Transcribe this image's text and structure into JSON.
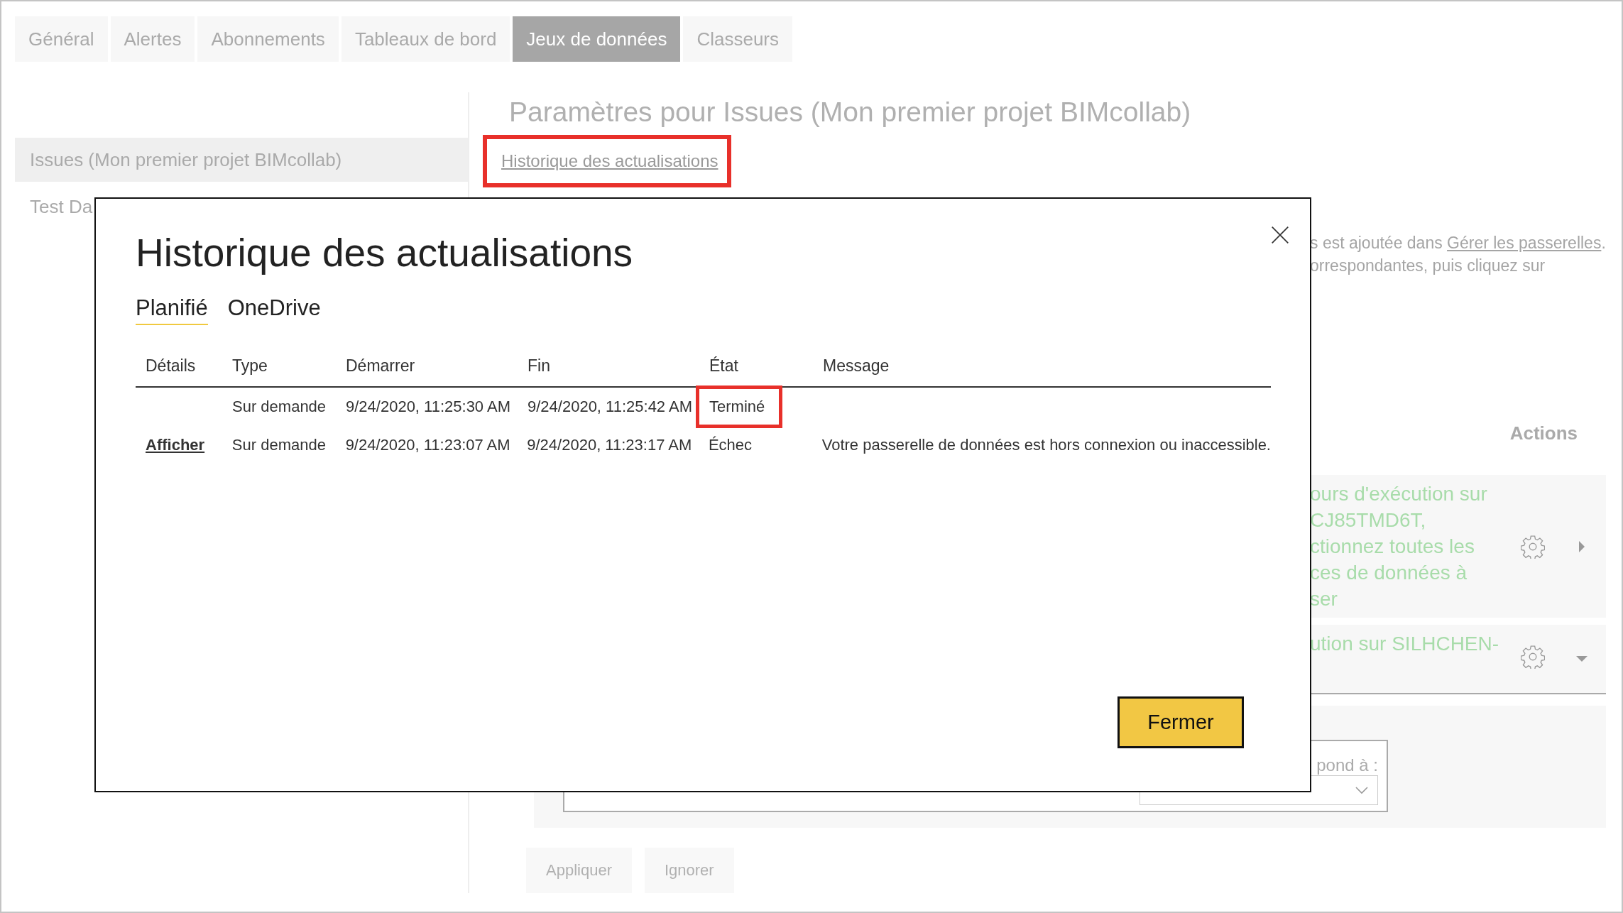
{
  "tabs": [
    {
      "label": "Général",
      "selected": false
    },
    {
      "label": "Alertes",
      "selected": false
    },
    {
      "label": "Abonnements",
      "selected": false
    },
    {
      "label": "Tableaux de bord",
      "selected": false
    },
    {
      "label": "Jeux de données",
      "selected": true
    },
    {
      "label": "Classeurs",
      "selected": false
    }
  ],
  "sidebar": {
    "items": [
      {
        "label": "Issues (Mon premier projet BIMcollab)",
        "selected": true
      },
      {
        "label": "Test Da",
        "selected": false
      }
    ]
  },
  "settings": {
    "title": "Paramètres pour Issues (Mon premier projet BIMcollab)",
    "history_link": {
      "label": "Historique des actualisations",
      "highlighted": true
    },
    "gateway_note": {
      "text": "s est ajoutée dans ",
      "link": "Gérer les passerelles",
      "end": "."
    },
    "gateway_note_2": "orrespondantes, puis cliquez sur",
    "actions_header": "Actions",
    "gateways": [
      {
        "lines": [
          "ours d'exécution sur",
          "CJ85TMD6T,",
          "ctionnez toutes les",
          "ces de données à",
          "ser"
        ],
        "expanded": false
      },
      {
        "lines": [
          "ution sur SILHCHEN-"
        ],
        "expanded": true
      }
    ],
    "mapping": {
      "label": "pond à :"
    },
    "buttons": [
      "Appliquer",
      "Ignorer"
    ]
  },
  "dialog": {
    "title": "Historique des actualisations",
    "tabs": [
      {
        "label": "Planifié",
        "selected": true
      },
      {
        "label": "OneDrive",
        "selected": false
      }
    ],
    "columns": [
      "Détails",
      "Type",
      "Démarrer",
      "Fin",
      "État",
      "Message"
    ],
    "rows": [
      {
        "type": "Sur demande",
        "start": "9/24/2020, 11:25:30 AM",
        "end": "9/24/2020, 11:25:42 AM",
        "status": "Terminé",
        "status_highlighted": true
      },
      {
        "details": "Afficher",
        "type": "Sur demande",
        "start": "9/24/2020, 11:23:07 AM",
        "end": "9/24/2020, 11:23:17 AM",
        "status": "Échec",
        "status_highlighted": false,
        "message": "Votre passerelle de données est hors connexion ou inaccessible."
      }
    ],
    "close_button": "Fermer"
  }
}
